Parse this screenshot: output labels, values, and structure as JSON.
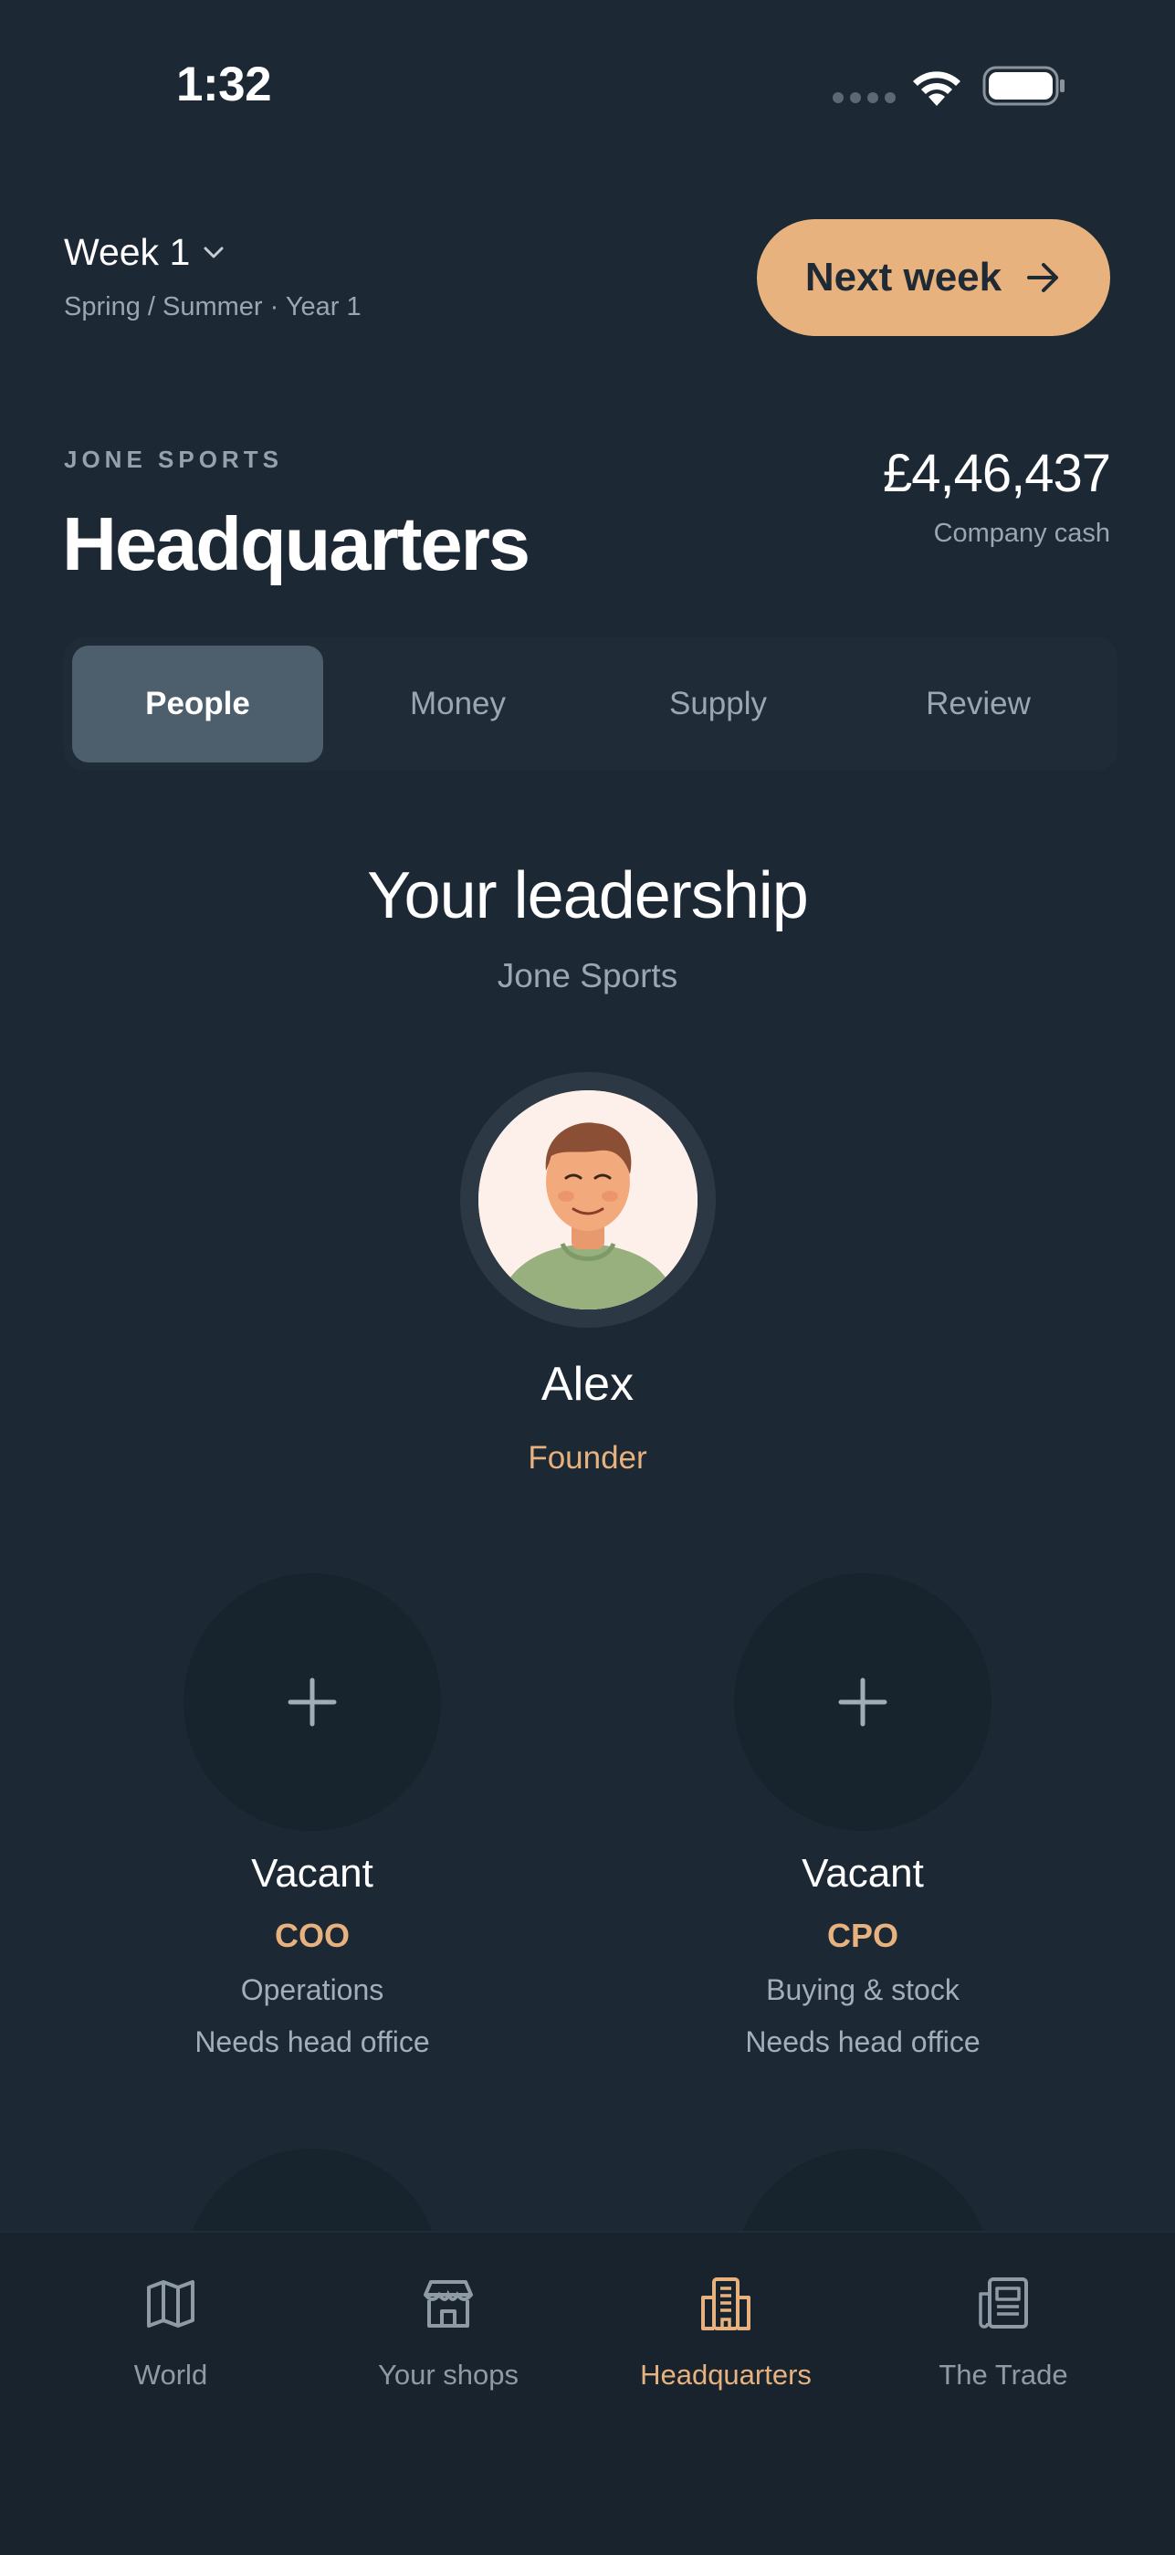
{
  "status_bar": {
    "time": "1:32"
  },
  "week": {
    "label": "Week 1",
    "season": "Spring / Summer · Year 1"
  },
  "next_week_button": {
    "label": "Next week"
  },
  "company": {
    "name": "JONE SPORTS",
    "page_title": "Headquarters",
    "cash": "£4,46,437",
    "cash_label": "Company cash"
  },
  "tabs": [
    {
      "label": "People",
      "active": true
    },
    {
      "label": "Money",
      "active": false
    },
    {
      "label": "Supply",
      "active": false
    },
    {
      "label": "Review",
      "active": false
    }
  ],
  "leadership": {
    "title": "Your leadership",
    "subtitle": "Jone Sports",
    "founder": {
      "name": "Alex",
      "role": "Founder"
    },
    "slots": [
      {
        "status": "Vacant",
        "role": "COO",
        "area": "Operations",
        "requirement": "Needs head office"
      },
      {
        "status": "Vacant",
        "role": "CPO",
        "area": "Buying & stock",
        "requirement": "Needs head office"
      }
    ]
  },
  "bottom_nav": [
    {
      "label": "World",
      "icon": "map-icon",
      "active": false
    },
    {
      "label": "Your shops",
      "icon": "store-icon",
      "active": false
    },
    {
      "label": "Headquarters",
      "icon": "building-icon",
      "active": true
    },
    {
      "label": "The Trade",
      "icon": "newspaper-icon",
      "active": false
    }
  ],
  "colors": {
    "background": "#1c2834",
    "accent": "#e8b27f",
    "muted_text": "#9aa6b1",
    "active_tab": "#4d5f6d"
  }
}
